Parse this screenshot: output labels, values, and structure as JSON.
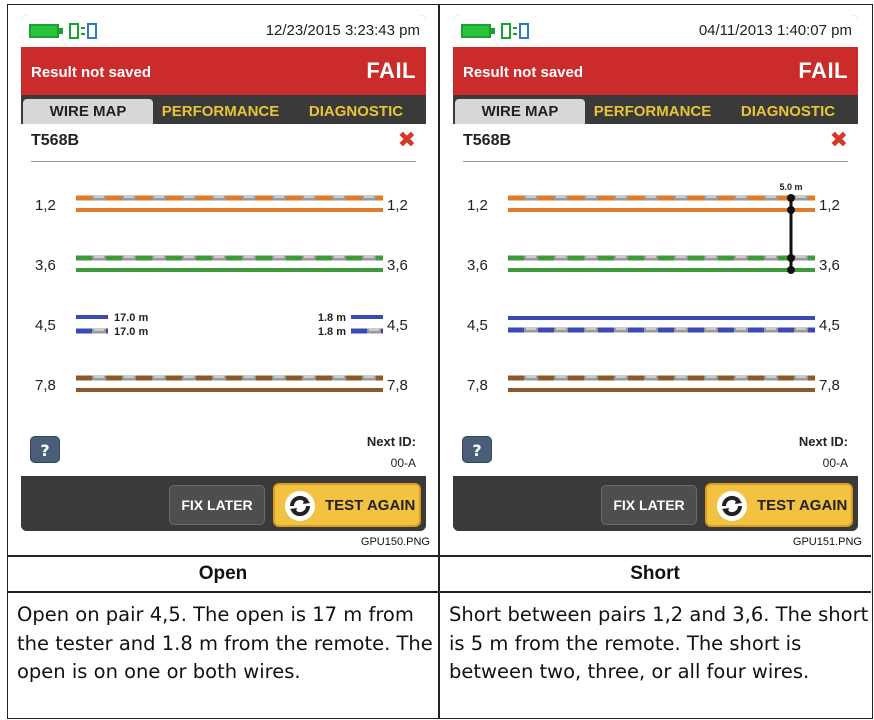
{
  "panels": [
    {
      "status": {
        "timestamp": "12/23/2015 3:23:43 pm"
      },
      "result": {
        "saved_text": "Result not saved",
        "verdict": "FAIL"
      },
      "tabs": [
        "WIRE MAP",
        "PERFORMANCE",
        "DIAGNOSTIC"
      ],
      "standard": "T568B",
      "pairs": [
        {
          "left_label": "1,2",
          "right_label": "1,2",
          "stripe": "orange"
        },
        {
          "left_label": "3,6",
          "right_label": "3,6",
          "stripe": "green"
        },
        {
          "left_label": "4,5",
          "right_label": "4,5",
          "stripe": "blue",
          "open": {
            "near_top": "17.0 m",
            "near_bottom": "17.0 m",
            "far_top": "1.8 m",
            "far_bottom": "1.8 m"
          }
        },
        {
          "left_label": "7,8",
          "right_label": "7,8",
          "stripe": "brown"
        }
      ],
      "help_label": "?",
      "next_id_label": "Next ID:",
      "next_id": "00-A",
      "fix_later": "FIX LATER",
      "test_again": "TEST AGAIN",
      "filename": "GPU150.PNG",
      "title": "Open",
      "description": "Open on pair 4,5. The open is 17 m from the tester and 1.8 m from the remote. The open is on one or both wires."
    },
    {
      "status": {
        "timestamp": "04/11/2013 1:40:07 pm"
      },
      "result": {
        "saved_text": "Result not saved",
        "verdict": "FAIL"
      },
      "tabs": [
        "WIRE MAP",
        "PERFORMANCE",
        "DIAGNOSTIC"
      ],
      "standard": "T568B",
      "pairs": [
        {
          "left_label": "1,2",
          "right_label": "1,2",
          "stripe": "orange"
        },
        {
          "left_label": "3,6",
          "right_label": "3,6",
          "stripe": "green"
        },
        {
          "left_label": "4,5",
          "right_label": "4,5",
          "stripe": "blue"
        },
        {
          "left_label": "7,8",
          "right_label": "7,8",
          "stripe": "brown"
        }
      ],
      "short_distance": "5.0 m",
      "help_label": "?",
      "next_id_label": "Next ID:",
      "next_id": "00-A",
      "fix_later": "FIX LATER",
      "test_again": "TEST AGAIN",
      "filename": "GPU151.PNG",
      "title": "Short",
      "description": "Short between pairs 1,2 and 3,6. The short is 5 m from the remote. The short is between two, three, or all four wires."
    }
  ],
  "colors": {
    "fail_red": "#cc2b2b",
    "tab_yellow": "#e8c533",
    "button_yellow": "#f2c240",
    "orange": "#e07b2a",
    "green": "#3f9a3a",
    "blue": "#3a48b8",
    "brown": "#8b5a2b"
  }
}
